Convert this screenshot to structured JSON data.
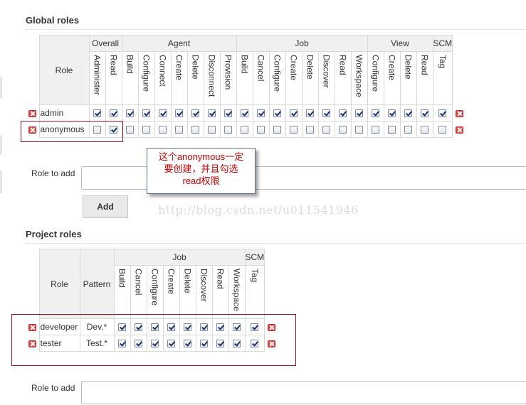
{
  "global": {
    "title": "Global roles",
    "role_header": "Role",
    "groups": [
      {
        "label": "Overall",
        "cols": [
          "Administer",
          "Read"
        ]
      },
      {
        "label": "Agent",
        "cols": [
          "Build",
          "Configure",
          "Connect",
          "Create",
          "Delete",
          "Disconnect",
          "Provision"
        ]
      },
      {
        "label": "Job",
        "cols": [
          "Build",
          "Cancel",
          "Configure",
          "Create",
          "Delete",
          "Discover",
          "Read",
          "Workspace"
        ]
      },
      {
        "label": "View",
        "cols": [
          "Configure",
          "Create",
          "Delete",
          "Read"
        ]
      },
      {
        "label": "SCM",
        "cols": [
          "Tag"
        ]
      }
    ],
    "rows": [
      {
        "name": "admin",
        "checks": [
          true,
          true,
          true,
          true,
          true,
          true,
          true,
          true,
          true,
          true,
          true,
          true,
          true,
          true,
          true,
          true,
          true,
          true,
          true,
          true,
          true,
          true
        ]
      },
      {
        "name": "anonymous",
        "checks": [
          false,
          true,
          false,
          false,
          false,
          false,
          false,
          false,
          false,
          false,
          false,
          false,
          false,
          false,
          false,
          false,
          false,
          false,
          false,
          false,
          false,
          false
        ]
      }
    ],
    "role_to_add_label": "Role to add",
    "add_button": "Add"
  },
  "project": {
    "title": "Project roles",
    "role_header": "Role",
    "pattern_header": "Pattern",
    "groups": [
      {
        "label": "Job",
        "cols": [
          "Build",
          "Cancel",
          "Configure",
          "Create",
          "Delete",
          "Discover",
          "Read",
          "Workspace"
        ]
      },
      {
        "label": "SCM",
        "cols": [
          "Tag"
        ]
      }
    ],
    "rows": [
      {
        "name": "developer",
        "pattern": "Dev.*",
        "checks": [
          true,
          true,
          true,
          true,
          true,
          true,
          true,
          true,
          true
        ]
      },
      {
        "name": "tester",
        "pattern": "Test.*",
        "checks": [
          true,
          true,
          true,
          true,
          true,
          true,
          true,
          true,
          true
        ]
      }
    ],
    "role_to_add_label": "Role to add"
  },
  "callout": {
    "lines": [
      "这个anonymous一定",
      "要创建，并且勾选",
      "read权限"
    ]
  },
  "watermark": "http://blog.csdn.net/u011541946",
  "colors": {
    "annotation_red": "#a0161a",
    "callout_text": "#c80000",
    "delete_icon": "#e04848"
  }
}
